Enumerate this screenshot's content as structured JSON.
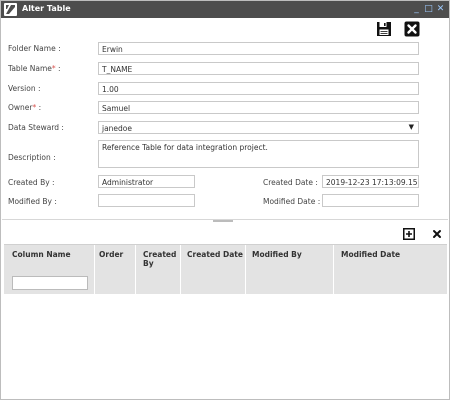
{
  "window": {
    "title": "Alter Table"
  },
  "title_controls": {
    "minimize": "_",
    "maximize": "□",
    "close": "✕"
  },
  "toolbar": {
    "save_icon": "save-icon",
    "close_icon": "close-icon"
  },
  "form": {
    "folder_name": {
      "label": "Folder Name :",
      "value": "Erwin"
    },
    "table_name": {
      "label": "Table Name",
      "required_mark": "*",
      "suffix": " :",
      "value": "T_NAME"
    },
    "version": {
      "label": "Version :",
      "value": "1.00"
    },
    "owner": {
      "label": "Owner",
      "required_mark": "*",
      "suffix": " :",
      "value": "Samuel"
    },
    "data_steward": {
      "label": "Data Steward :",
      "value": "janedoe",
      "arrow": "▼"
    },
    "description": {
      "label": "Description :",
      "value": "Reference Table for data integration project."
    },
    "created_by": {
      "label": "Created By :",
      "value": "Administrator"
    },
    "created_date": {
      "label": "Created Date :",
      "value": "2019-12-23 17:13:09.15"
    },
    "modified_by": {
      "label": "Modified By :",
      "value": ""
    },
    "modified_date": {
      "label": "Modified Date :",
      "value": ""
    }
  },
  "grid": {
    "tools": {
      "add": "add-icon",
      "remove": "close-icon"
    },
    "columns": [
      {
        "label": "Column Name"
      },
      {
        "label": "Order"
      },
      {
        "label": "Created By"
      },
      {
        "label": "Created Date"
      },
      {
        "label": "Modified By"
      },
      {
        "label": "Modified Date"
      }
    ]
  },
  "colors": {
    "titlebar": "#4d4d4d",
    "grid_header": "#e3e3e3",
    "required": "#d9534f"
  }
}
